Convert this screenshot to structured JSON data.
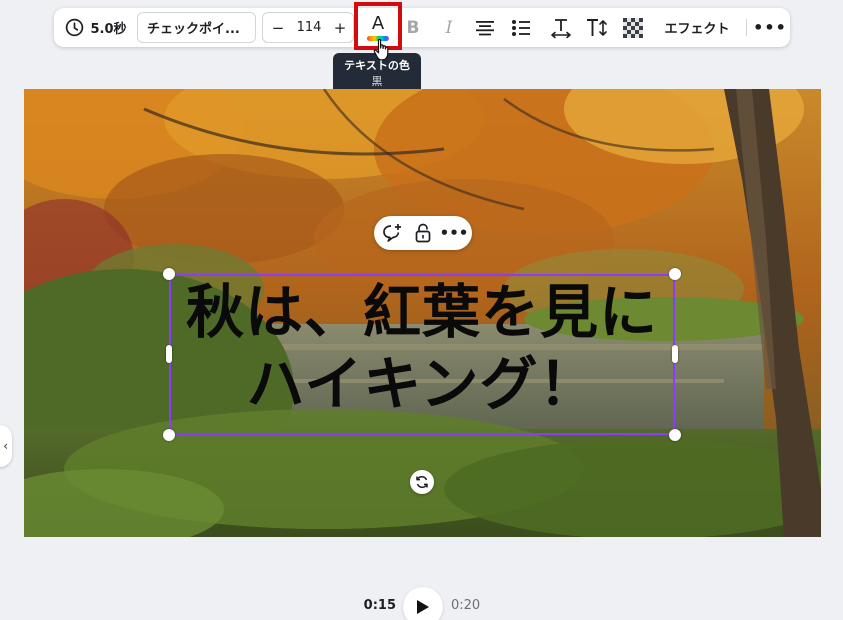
{
  "toolbar": {
    "duration": "5.0秒",
    "font_name": "チェックポイ...",
    "font_size_minus": "−",
    "font_size": "114",
    "font_size_plus": "+",
    "text_color_glyph": "A",
    "bold": "B",
    "italic": "I",
    "effect": "エフェクト",
    "more": "•••"
  },
  "tooltip": {
    "title": "テキストの色",
    "value": "黒"
  },
  "canvas": {
    "headline_line1": "秋は、紅葉を見に",
    "headline_line2": "ハイキング！",
    "text_color": "#0a0a0a",
    "selection_color": "#8b3dff"
  },
  "side_handle": "‹",
  "playback": {
    "current": "0:15",
    "total": "0:20"
  },
  "icons": {
    "duration": "clock-icon",
    "text_color": "text-color-icon",
    "align": "align-center-icon",
    "list": "list-icon",
    "spacing": "spacing-icon",
    "text_size": "text-size-icon",
    "transparency": "transparency-icon",
    "comment": "comment-add-icon",
    "lock": "lock-icon",
    "rotate": "rotate-icon",
    "play": "play-icon"
  },
  "colors": {
    "highlight": "#d20c0c",
    "tooltip_bg": "#232b38"
  }
}
